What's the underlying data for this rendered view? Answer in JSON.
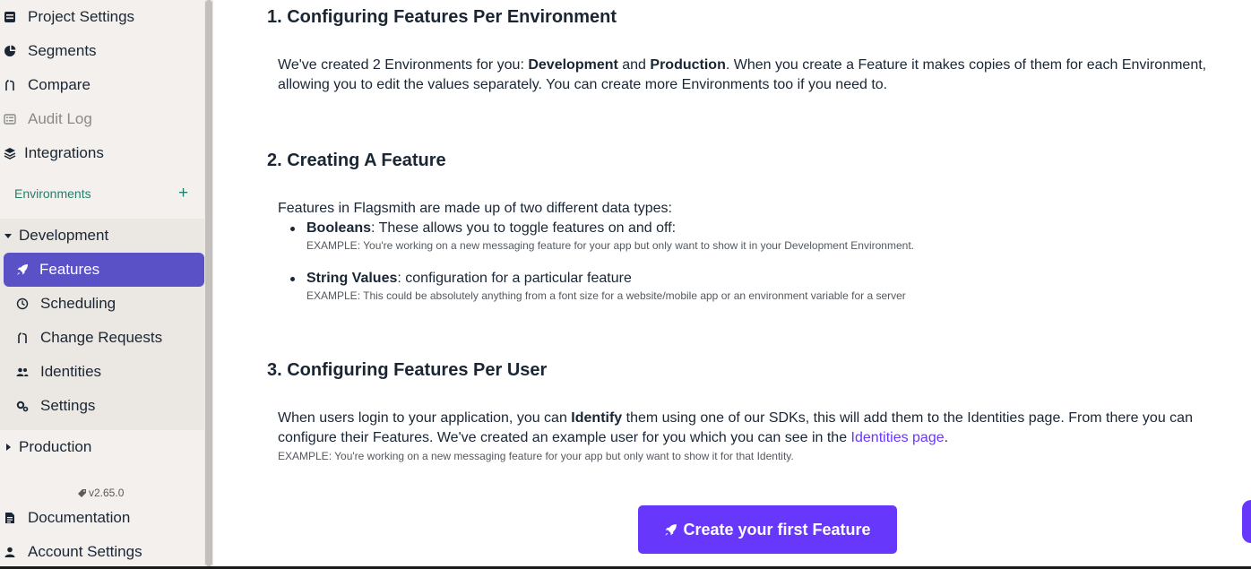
{
  "sidebar": {
    "top_items": [
      {
        "label": "Project Settings",
        "icon": "project-settings-icon"
      },
      {
        "label": "Segments",
        "icon": "pie-chart-icon"
      },
      {
        "label": "Compare",
        "icon": "compare-icon"
      },
      {
        "label": "Audit Log",
        "icon": "list-icon"
      },
      {
        "label": "Integrations",
        "icon": "layers-icon"
      }
    ],
    "environments_label": "Environments",
    "environments_add": "+",
    "development": {
      "label": "Development",
      "items": [
        {
          "label": "Features",
          "icon": "rocket-icon"
        },
        {
          "label": "Scheduling",
          "icon": "clock-icon"
        },
        {
          "label": "Change Requests",
          "icon": "compare-icon"
        },
        {
          "label": "Identities",
          "icon": "users-icon"
        },
        {
          "label": "Settings",
          "icon": "gear-icon"
        }
      ]
    },
    "production_label": "Production",
    "version": "v2.65.0",
    "bottom_items": [
      {
        "label": "Documentation",
        "icon": "document-icon"
      },
      {
        "label": "Account Settings",
        "icon": "user-icon"
      }
    ]
  },
  "main": {
    "section1": {
      "title": "1. Configuring Features Per Environment",
      "p_start": "We've created 2 Environments for you: ",
      "env1": "Development",
      "and": " and ",
      "env2": "Production",
      "p_end": ". When you create a Feature it makes copies of them for each Environment, allowing you to edit the values separately. You can create more Environments too if you need to."
    },
    "section2": {
      "title": "2. Creating A Feature",
      "intro": "Features in Flagsmith are made up of two different data types:",
      "bullets": [
        {
          "term": "Booleans",
          "desc": ": These allows you to toggle features on and off:",
          "example": "EXAMPLE: You're working on a new messaging feature for your app but only want to show it in your Development Environment."
        },
        {
          "term": "String Values",
          "desc": ": configuration for a particular feature",
          "example": "EXAMPLE: This could be absolutely anything from a font size for a website/mobile app or an environment variable for a server"
        }
      ]
    },
    "section3": {
      "title": "3. Configuring Features Per User",
      "p_start": "When users login to your application, you can ",
      "identify": "Identify",
      "p_mid": " them using one of our SDKs, this will add them to the Identities page. From there you can configure their Features. We've created an example user for you which you can see in the ",
      "link": "Identities page",
      "p_end": ".",
      "example": "EXAMPLE: You're working on a new messaging feature for your app but only want to show it for that Identity."
    },
    "cta_label": "Create your first Feature"
  },
  "colors": {
    "accent": "#6837fc",
    "active_nav": "#5a51c6",
    "env_green": "#27806b"
  }
}
